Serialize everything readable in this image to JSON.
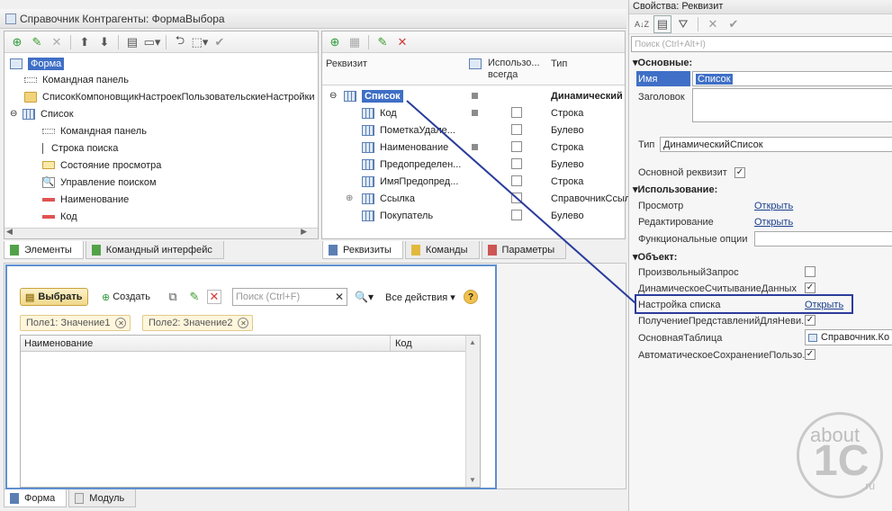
{
  "window": {
    "title": "Справочник Контрагенты: ФормаВыбора"
  },
  "elements_tree": {
    "root": "Форма",
    "items": [
      {
        "label": "Командная панель",
        "icon": "command-panel-icon"
      },
      {
        "label": "СписокКомпоновщикНастроекПользовательскиеНастройки",
        "icon": "folder-icon"
      },
      {
        "label": "Список",
        "icon": "table-icon"
      },
      {
        "label": "Командная панель",
        "icon": "command-panel-icon"
      },
      {
        "label": "Строка поиска",
        "icon": "search-string-icon"
      },
      {
        "label": "Состояние просмотра",
        "icon": "view-state-icon"
      },
      {
        "label": "Управление поиском",
        "icon": "search-control-icon"
      },
      {
        "label": "Наименование",
        "icon": "field-icon"
      },
      {
        "label": "Код",
        "icon": "field-icon"
      }
    ]
  },
  "left_tabs": [
    "Элементы",
    "Командный интерфейс"
  ],
  "requisites": {
    "headers": {
      "requisite": "Реквизит",
      "use_always": "Использо...\nвсегда",
      "type": "Тип"
    },
    "rows": [
      {
        "name": "Список",
        "type": "Динамический",
        "bold": true,
        "square": true,
        "check": false
      },
      {
        "name": "Код",
        "type": "Строка",
        "square": true,
        "check": true
      },
      {
        "name": "ПометкаУдале...",
        "type": "Булево",
        "square": false,
        "check": true
      },
      {
        "name": "Наименование",
        "type": "Строка",
        "square": true,
        "check": true
      },
      {
        "name": "Предопределен...",
        "type": "Булево",
        "square": false,
        "check": true
      },
      {
        "name": "ИмяПредопред...",
        "type": "Строка",
        "square": false,
        "check": true
      },
      {
        "name": "Ссылка",
        "type": "СправочникСсыл",
        "square": false,
        "check": true
      },
      {
        "name": "Покупатель",
        "type": "Булево",
        "square": false,
        "check": true
      }
    ]
  },
  "mid_tabs": [
    "Реквизиты",
    "Команды",
    "Параметры"
  ],
  "preview": {
    "select_button": "Выбрать",
    "create_button": "Создать",
    "search_placeholder": "Поиск (Ctrl+F)",
    "all_actions": "Все действия",
    "chips": [
      "Поле1: Значение1",
      "Поле2: Значение2"
    ],
    "columns": [
      "Наименование",
      "Код"
    ]
  },
  "bottom_tabs": [
    "Форма",
    "Модуль"
  ],
  "properties": {
    "title": "Свойства: Реквизит",
    "search_placeholder": "Поиск (Ctrl+Alt+I)",
    "sections": {
      "main": "Основные:",
      "usage": "Использование:",
      "object": "Объект:"
    },
    "name_label": "Имя",
    "name_value": "Список",
    "header_label": "Заголовок",
    "type_label": "Тип",
    "type_value": "ДинамическийСписок",
    "main_requisite_label": "Основной реквизит",
    "view_label": "Просмотр",
    "edit_label": "Редактирование",
    "func_options_label": "Функциональные опции",
    "open_link": "Открыть",
    "arbitrary_query_label": "ПроизвольныйЗапрос",
    "dynamic_read_label": "ДинамическоеСчитываниеДанных",
    "list_settings_label": "Настройка списка",
    "get_views_label": "ПолучениеПредставленийДляНеви...",
    "main_table_label": "ОсновнаяТаблица",
    "main_table_value": "Справочник.Ко",
    "autosave_label": "АвтоматическоеСохранениеПользо..."
  },
  "watermark": {
    "line1": "about",
    "line2": "1C",
    "line3": ".ru"
  },
  "colors": {
    "highlight_border": "#2b3c9c",
    "selection": "#3f6fc6",
    "link": "#1a3f8b"
  }
}
